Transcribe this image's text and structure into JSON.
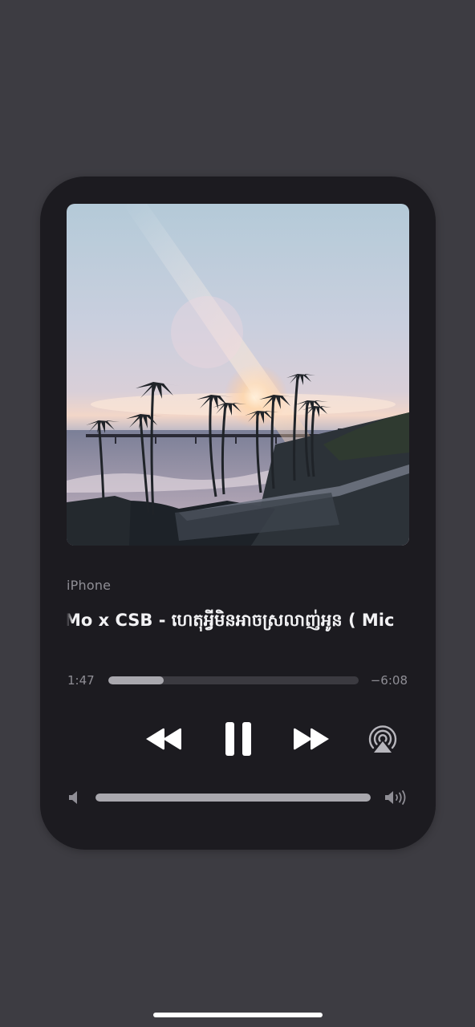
{
  "now_playing": {
    "device": "iPhone",
    "title": "Mo x CSB - ហេតុអ្វីមិនអាចស្រលាញ់អូន ( Mic",
    "time_elapsed": "1:47",
    "time_remaining": "−6:08",
    "progress_fraction": 0.22,
    "volume_fraction": 1.0
  },
  "controls": {
    "rewind_icon": "rewind-icon",
    "pause_icon": "pause-icon",
    "forward_icon": "fast-forward-icon",
    "airplay_icon": "airplay-audio-icon",
    "volume_low_icon": "speaker-low-icon",
    "volume_high_icon": "speaker-high-icon"
  },
  "colors": {
    "page_background": "#3d3c42",
    "card_background": "#1c1b20",
    "primary_text": "#f2f2f4",
    "secondary_text": "#8f8e95",
    "track": "#3b3a40",
    "track_fill": "#a9a8ae",
    "controls": "#ffffff"
  }
}
